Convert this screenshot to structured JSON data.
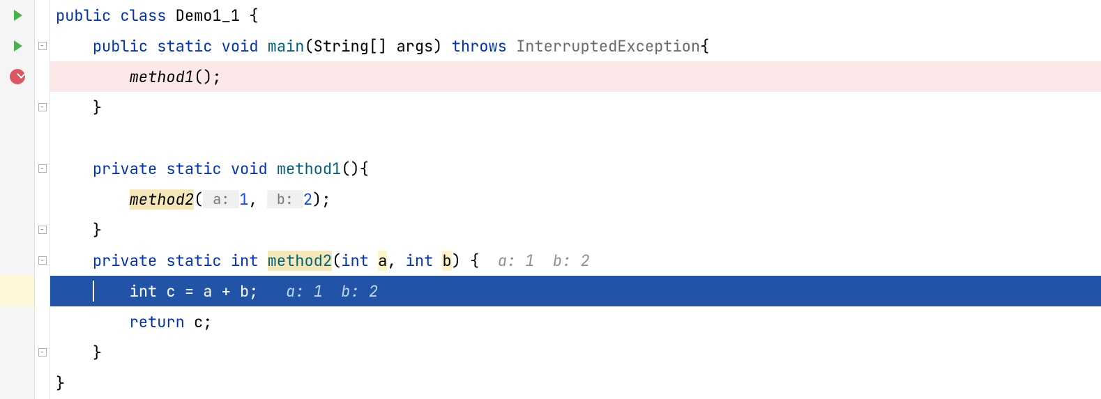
{
  "lines": {
    "l1": {
      "kw1": "public",
      "kw2": "class",
      "name": "Demo1_1",
      "brace": " {"
    },
    "l2": {
      "indent": "    ",
      "kw1": "public",
      "kw2": "static",
      "kw3": "void",
      "name": "main",
      "params": "(String[] args)",
      "kw4": "throws",
      "exc": "InterruptedException",
      "brace": "{"
    },
    "l3": {
      "indent": "        ",
      "call": "method1",
      "rest": "();"
    },
    "l4": {
      "indent": "    ",
      "brace": "}"
    },
    "l5": {
      "text": ""
    },
    "l6": {
      "indent": "    ",
      "kw1": "private",
      "kw2": "static",
      "kw3": "void",
      "name": "method1",
      "params": "(){"
    },
    "l7": {
      "indent": "        ",
      "call": "method2",
      "open": "(",
      "hint_a": " a: ",
      "val_a": "1",
      "comma": ", ",
      "hint_b": " b: ",
      "val_b": "2",
      "close": ");"
    },
    "l8": {
      "indent": "    ",
      "brace": "}"
    },
    "l9": {
      "indent": "    ",
      "kw1": "private",
      "kw2": "static",
      "kw3": "int",
      "name": "method2",
      "open": "(",
      "t1": "int",
      "p1": "a",
      "comma": ", ",
      "t2": "int",
      "p2": "b",
      "close": ") {",
      "hint": "  a: 1  b: 2"
    },
    "l10": {
      "indent": "        ",
      "kw": "int",
      "rest": " c = a + b;",
      "hint": "   a: 1  b: 2"
    },
    "l11": {
      "indent": "        ",
      "kw": "return",
      "rest": " c;"
    },
    "l12": {
      "indent": "    ",
      "brace": "}"
    },
    "l13": {
      "brace": "}"
    }
  }
}
